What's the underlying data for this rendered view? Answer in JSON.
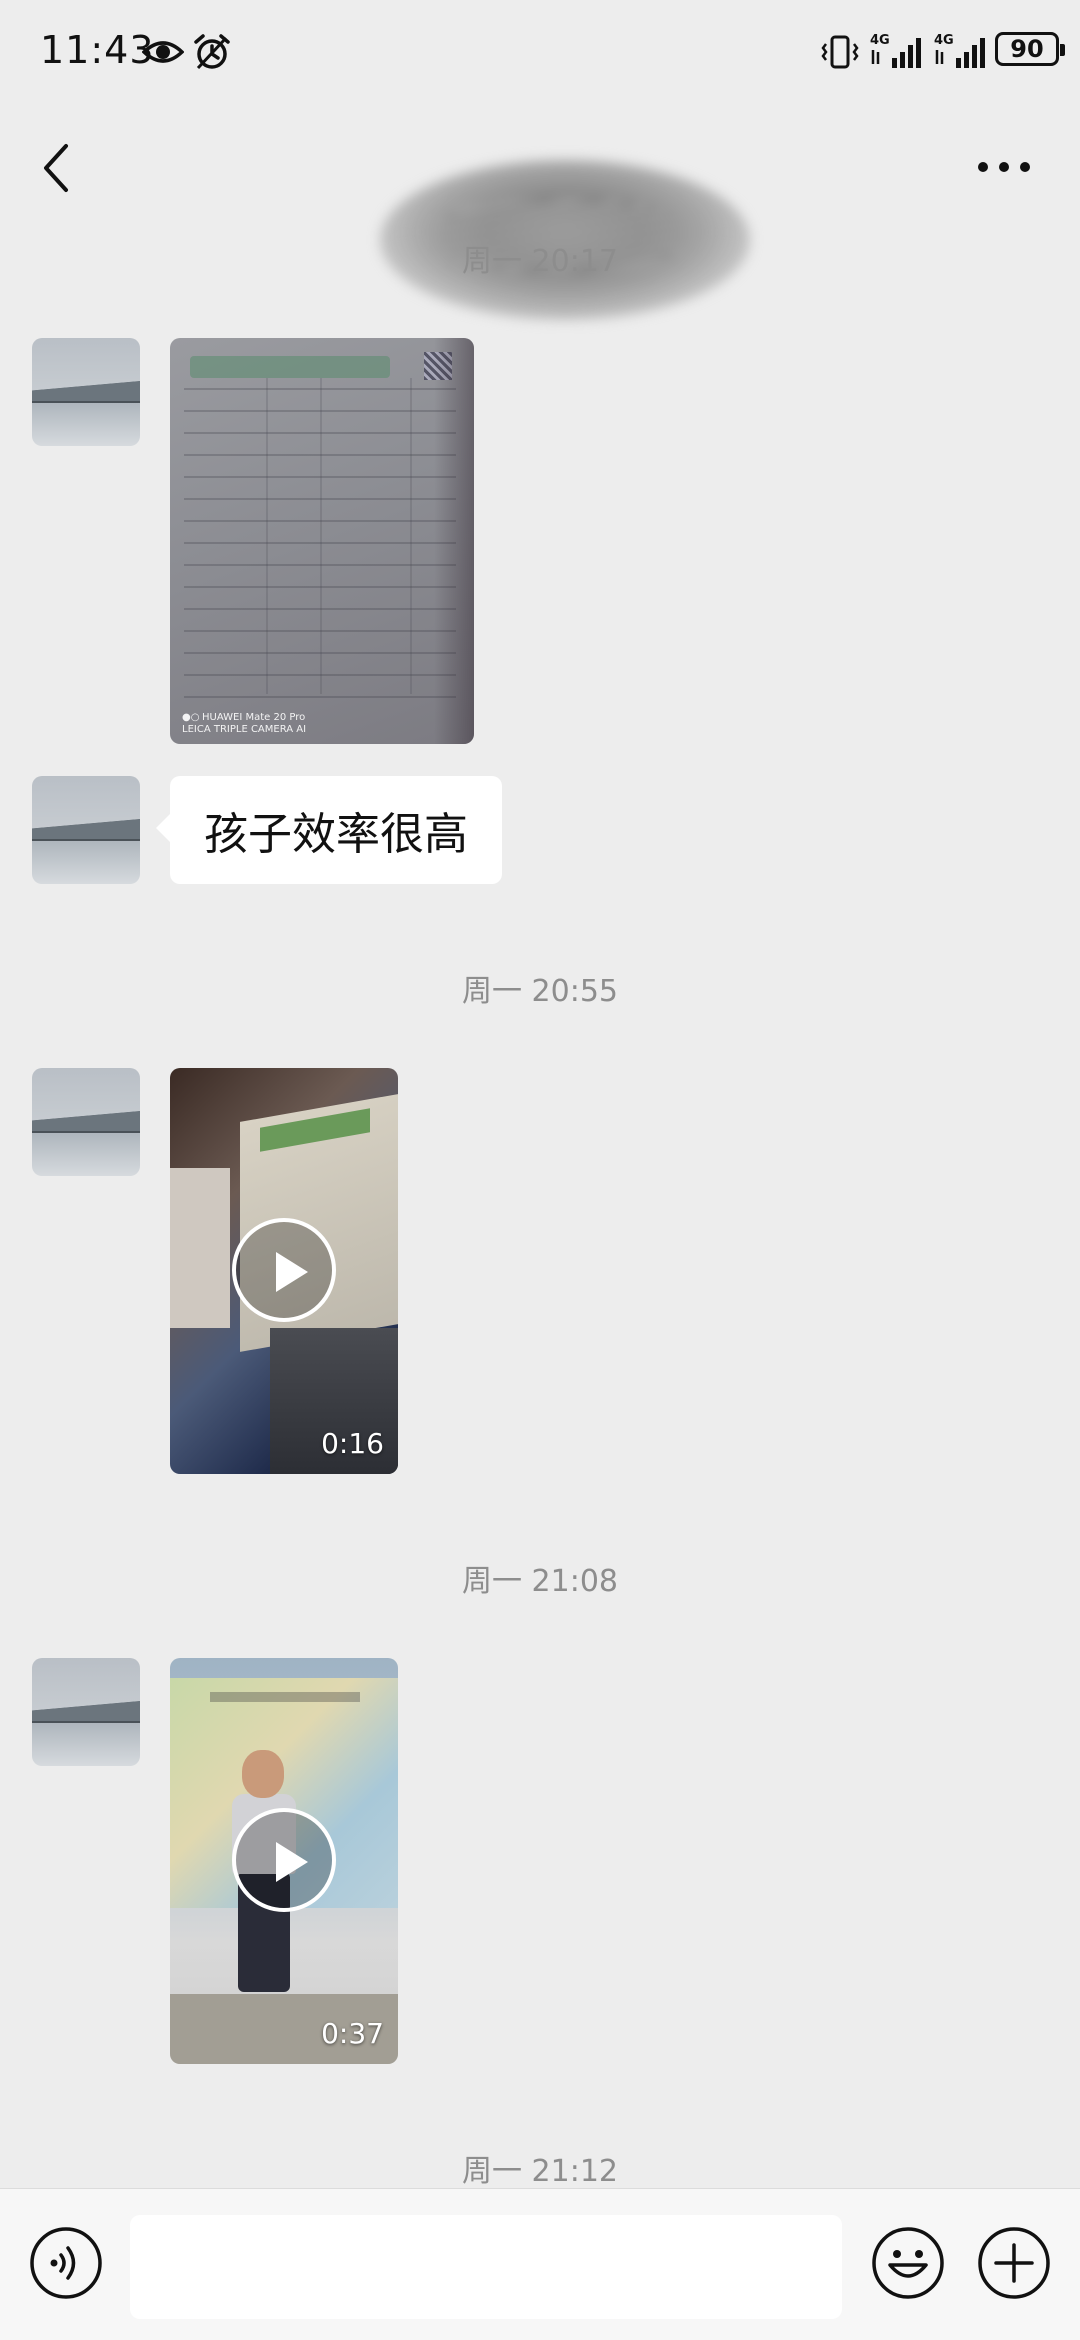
{
  "status_bar": {
    "time": "11:43",
    "network_1": "4G",
    "network_2": "4G",
    "battery": "90"
  },
  "header": {
    "back_icon": "chevron-left-icon",
    "more_icon": "ellipsis-icon",
    "title_redacted": true
  },
  "messages": [
    {
      "type": "timestamp",
      "text": "周一 20:17"
    },
    {
      "type": "image",
      "from": "contact",
      "watermark_line1": "HUAWEI Mate 20 Pro",
      "watermark_line2": "LEICA TRIPLE CAMERA AI"
    },
    {
      "type": "text",
      "from": "contact",
      "text": "孩子效率很高"
    },
    {
      "type": "timestamp",
      "text": "周一 20:55"
    },
    {
      "type": "video",
      "from": "contact",
      "duration": "0:16"
    },
    {
      "type": "timestamp",
      "text": "周一 21:08"
    },
    {
      "type": "video",
      "from": "contact",
      "duration": "0:37"
    },
    {
      "type": "timestamp",
      "text": "周一 21:12"
    }
  ],
  "input_bar": {
    "voice_icon": "voice-icon",
    "text_value": "",
    "emoji_icon": "smiley-icon",
    "plus_icon": "plus-circle-icon"
  }
}
